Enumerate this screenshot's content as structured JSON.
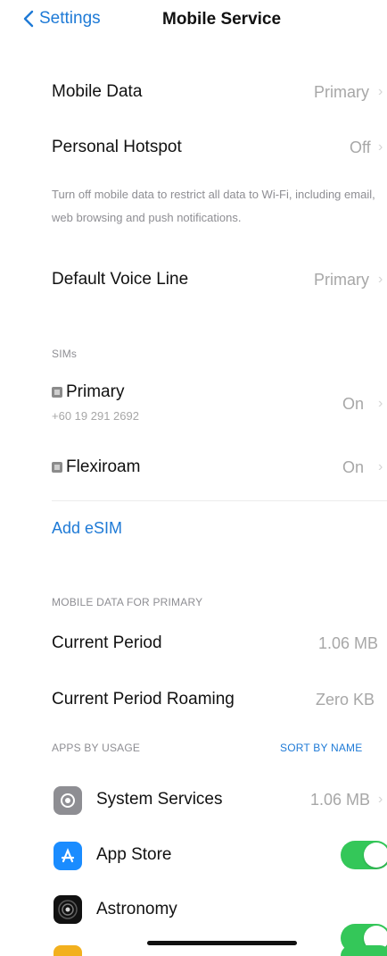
{
  "nav": {
    "back_label": "Settings",
    "title": "Mobile Service"
  },
  "rows": {
    "mobile_data": {
      "label": "Mobile Data",
      "value": "Primary"
    },
    "personal_hotspot": {
      "label": "Personal Hotspot",
      "value": "Off"
    },
    "footnote": "Turn off mobile data to restrict all data to Wi-Fi, including email, web browsing and push notifications.",
    "default_voice_line": {
      "label": "Default Voice Line",
      "value": "Primary"
    }
  },
  "sims": {
    "header": "SIMs",
    "items": [
      {
        "name": "Primary",
        "number": "+60 19 291 2692",
        "status": "On"
      },
      {
        "name": "Flexiroam",
        "status": "On"
      }
    ],
    "add_esim": "Add eSIM"
  },
  "mobile_data_section": {
    "header": "MOBILE DATA FOR PRIMARY",
    "current_period": {
      "label": "Current Period",
      "value": "1.06 MB"
    },
    "current_period_roaming": {
      "label": "Current Period Roaming",
      "value": "Zero KB"
    }
  },
  "apps": {
    "header": "APPS BY USAGE",
    "sort_label": "SORT BY NAME",
    "items": [
      {
        "name": "System Services",
        "value": "1.06 MB",
        "icon": "gear-icon",
        "color": "#8e8e93"
      },
      {
        "name": "App Store",
        "icon": "app-store-icon",
        "color": "#1a8cff",
        "enabled": true
      },
      {
        "name": "Astronomy",
        "icon": "astronomy-icon",
        "color": "#111111",
        "enabled": true
      }
    ]
  },
  "colors": {
    "accent": "#1e7ad6",
    "toggle_on": "#34c759"
  }
}
